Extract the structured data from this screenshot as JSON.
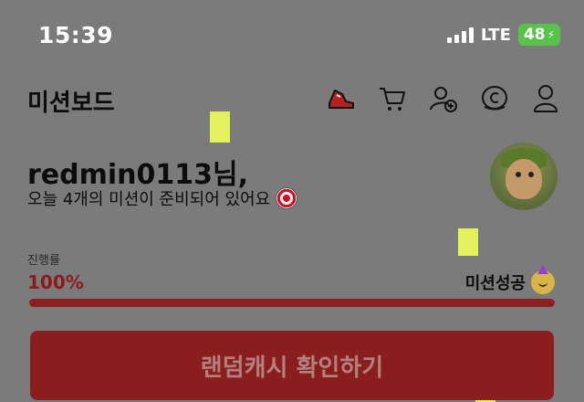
{
  "status_bar": {
    "time": "15:39",
    "network": "LTE",
    "battery": "48"
  },
  "header": {
    "title": "미션보드",
    "icons": [
      "sneaker-icon",
      "cart-icon",
      "add-friend-icon",
      "coin-icon",
      "profile-icon"
    ]
  },
  "greeting": {
    "name": "redmin0113님,",
    "subtitle": "오늘 4개의 미션이 준비되어 있어요",
    "subtitle_icon": "dart-target-icon"
  },
  "progress": {
    "label": "진행률",
    "percent_text": "100%",
    "value": 1.0,
    "status": "미션성공",
    "status_icon": "party-face-icon"
  },
  "cta": {
    "label": "랜덤캐시 확인하기"
  },
  "colors": {
    "accent": "#8c1f1f",
    "overlay_bg": "#7b7b7b",
    "marker": "#e2f25a"
  }
}
